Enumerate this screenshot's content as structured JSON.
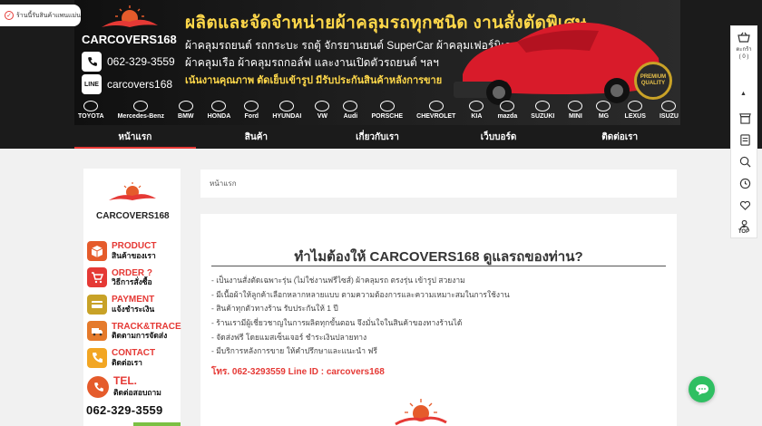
{
  "notice": {
    "label": "ร้านนี้รับสินค้าแพนแม่น"
  },
  "banner": {
    "title": "ผลิตและจัดจำหน่ายผ้าคลุมรถทุกชนิด งานสั่งตัดพิเศษ",
    "line1": "ผ้าคลุมรถยนต์ รถกระบะ รถตู้ จักรยานยนต์ SuperCar ผ้าคลุมเฟอร์นิเจอร์",
    "line2": "ผ้าคลุมเรือ ผ้าคลุมรถกอล์ฟ และงานเปิดตัวรถยนต์ ฯลฯ",
    "line3": "เน้นงานคุณภาพ ตัดเย็บเข้ารูป มีรับประกันสินค้าหลังการขาย",
    "brand_name": "CARCOVERS168",
    "phone": "062-329-3559",
    "line_id": "carcovers168",
    "line_badge": "LINE",
    "premium_badge": "PREMIUM QUALITY",
    "brands": [
      "TOYOTA",
      "Mercedes-Benz",
      "BMW",
      "HONDA",
      "Ford",
      "HYUNDAI",
      "VW",
      "Audi",
      "PORSCHE",
      "CHEVROLET",
      "KIA",
      "mazda",
      "SUZUKI",
      "MINI",
      "MG",
      "LEXUS",
      "ISUZU"
    ]
  },
  "nav": {
    "items": [
      "หน้าแรก",
      "สินค้า",
      "เกี่ยวกับเรา",
      "เว็บบอร์ด",
      "ติดต่อเรา"
    ],
    "active_index": 0
  },
  "sidebar": {
    "logo_text": "CARCOVERS168",
    "menu": [
      {
        "title": "PRODUCT",
        "sub": "สินค้าของเรา",
        "icon": "box-icon",
        "color": "#e55b2b"
      },
      {
        "title": "ORDER ?",
        "sub": "วิธีการสั่งซื้อ",
        "icon": "cart-icon",
        "color": "#e53935"
      },
      {
        "title": "PAYMENT",
        "sub": "แจ้งชำระเงิน",
        "icon": "payment-icon",
        "color": "#c8a227"
      },
      {
        "title": "TRACK&TRACE",
        "sub": "ติดตามการจัดส่ง",
        "icon": "truck-icon",
        "color": "#e57a2b"
      },
      {
        "title": "CONTACT",
        "sub": "ติดต่อเรา",
        "icon": "contact-icon",
        "color": "#f2a623"
      }
    ],
    "tel_title": "TEL.",
    "tel_sub": "ติดต่อสอบถาม",
    "tel_number": "062-329-3559"
  },
  "breadcrumb": {
    "home": "หน้าแรก"
  },
  "content": {
    "heading": "ทำไมต้องให้ CARCOVERS168 ดูแลรถของท่าน?",
    "bullets": [
      "- เป็นงานสั่งตัดเฉพาะรุ่น (ไม่ใช่งานฟรีไซส์) ผ้าคลุมรถ ตรงรุ่น เข้ารูป สวยงาม",
      "- มีเนื้อผ้าให้ลูกค้าเลือกหลากหลายแบบ ตามความต้องการและความเหมาะสมในการใช้งาน",
      "- สินค้าทุกตัวทางร้าน รับประกันให้  1 ปี",
      "- ร้านเรามีผู้เชี่ยวชาญในการผลิตทุกขั้นตอน จึงมั่นใจในสินค้าของทางร้านได้",
      "- จัดส่งฟรี โดยแมสเซ็นเจอร์ ชำระเงินปลายทาง",
      "- มีบริการหลังการขาย ให้คำปรึกษาและแนะนำ ฟรี"
    ],
    "contact_line": "โทร. 062-3293559  Line ID : carcovers168"
  },
  "rail": {
    "cart_label": "ตะกร้า",
    "cart_count": "( 0 )",
    "top_label": "TOP"
  },
  "colors": {
    "accent": "#e53935",
    "dark": "#1b1b1b",
    "gold": "#ffd84a",
    "chat": "#2fbf62"
  }
}
